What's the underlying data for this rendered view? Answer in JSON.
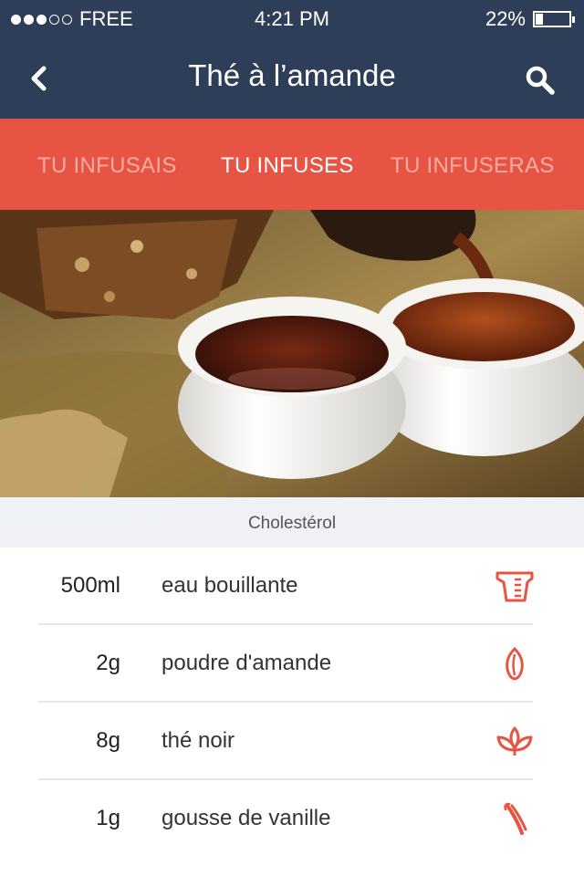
{
  "status": {
    "carrier": "FREE",
    "time": "4:21  PM",
    "battery": "22%",
    "battery_level": 0.22,
    "signal_bars": 3,
    "signal_total": 5
  },
  "nav": {
    "title": "Thé à l’amande",
    "back_icon": "chevron-left-icon",
    "search_icon": "search-icon"
  },
  "tabs": [
    {
      "label": "TU INFUSAIS",
      "active": false
    },
    {
      "label": "TU INFUSES",
      "active": true
    },
    {
      "label": "TU INFUSERAS",
      "active": false
    }
  ],
  "caption": "Cholestérol",
  "ingredients": [
    {
      "qty": "500ml",
      "name": "eau bouillante",
      "icon": "measuring-cup-icon"
    },
    {
      "qty": "2g",
      "name": "poudre d'amande",
      "icon": "almond-icon"
    },
    {
      "qty": "8g",
      "name": "thé noir",
      "icon": "tea-leaf-icon"
    },
    {
      "qty": "1g",
      "name": "gousse de vanille",
      "icon": "vanilla-pod-icon"
    }
  ],
  "colors": {
    "nav": "#2e3e59",
    "accent": "#e75444",
    "tab_inactive": "#f7ada2"
  }
}
